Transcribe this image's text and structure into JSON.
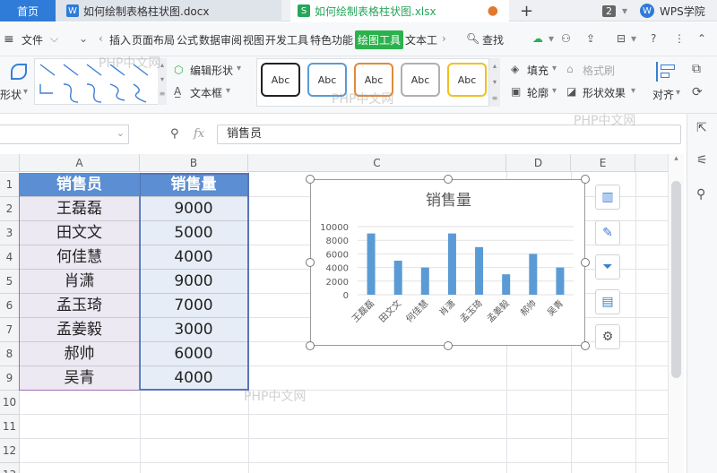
{
  "titlebar": {
    "home_label": "首页",
    "doc_tab": "如何绘制表格柱状图.docx",
    "xls_tab": "如何绘制表格柱状图.xlsx",
    "add_tab": "+",
    "window_count": "2",
    "brand": "WPS学院"
  },
  "menu": {
    "file": "文件",
    "items": [
      "插入",
      "页面布局",
      "公式",
      "数据",
      "审阅",
      "视图",
      "开发工具",
      "特色功能",
      "绘图工具",
      "文本工"
    ],
    "search": "查找"
  },
  "ribbon": {
    "shape_label": "形状",
    "edit_shape": "编辑形状",
    "text_box": "文本框",
    "styles": [
      "Abc",
      "Abc",
      "Abc",
      "Abc",
      "Abc"
    ],
    "fill": "填充",
    "format_brush": "格式刷",
    "outline": "轮廓",
    "shape_effect": "形状效果",
    "align": "对齐"
  },
  "formula": {
    "fx": "fx",
    "value": "销售员"
  },
  "sheet": {
    "columns": [
      "A",
      "B",
      "C",
      "D",
      "E"
    ],
    "rows": [
      "1",
      "2",
      "3",
      "4",
      "5",
      "6",
      "7",
      "8",
      "9",
      "10",
      "11",
      "12",
      "13"
    ],
    "header": [
      "销售员",
      "销售量"
    ],
    "data": [
      [
        "王磊磊",
        "9000"
      ],
      [
        "田文文",
        "5000"
      ],
      [
        "何佳慧",
        "4000"
      ],
      [
        "肖潇",
        "9000"
      ],
      [
        "孟玉琦",
        "7000"
      ],
      [
        "孟姜毅",
        "3000"
      ],
      [
        "郝帅",
        "6000"
      ],
      [
        "吴青",
        "4000"
      ]
    ]
  },
  "chart_data": {
    "type": "bar",
    "title": "销售量",
    "categories": [
      "王磊磊",
      "田文文",
      "何佳慧",
      "肖潇",
      "孟玉琦",
      "孟姜毅",
      "郝帅",
      "吴青"
    ],
    "values": [
      9000,
      5000,
      4000,
      9000,
      7000,
      3000,
      6000,
      4000
    ],
    "yticks": [
      "0",
      "2000",
      "4000",
      "6000",
      "8000",
      "10000"
    ],
    "ylim": [
      0,
      10000
    ],
    "bar_color": "#5b9bd5",
    "grid": true,
    "legend": "none"
  },
  "watermark": "PHP中文网",
  "colors": {
    "accent": "#2bb24c",
    "header_fill": "#5b8ed2",
    "home_tab": "#2f7bd8"
  }
}
